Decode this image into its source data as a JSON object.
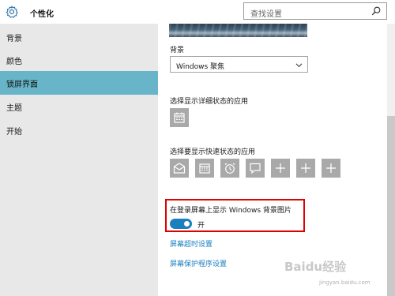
{
  "header": {
    "title": "个性化",
    "search_placeholder": "查找设置",
    "icon": "gear-icon"
  },
  "sidebar": {
    "items": [
      {
        "label": "背景",
        "selected": false
      },
      {
        "label": "颜色",
        "selected": false
      },
      {
        "label": "锁屏界面",
        "selected": true
      },
      {
        "label": "主题",
        "selected": false
      },
      {
        "label": "开始",
        "selected": false
      }
    ]
  },
  "main": {
    "background_label": "背景",
    "background_value": "Windows 聚焦",
    "detailed_status_label": "选择显示详细状态的应用",
    "quick_status_label": "选择要显示快速状态的应用",
    "quick_status_icons": [
      "mail-icon",
      "calendar-icon",
      "alarm-icon",
      "message-icon",
      "plus-icon",
      "plus-icon",
      "plus-icon"
    ],
    "show_bg_label": "在登录屏幕上显示 Windows 背景图片",
    "toggle_state": "开",
    "toggle_on": true,
    "link_timeout": "屏幕超时设置",
    "link_screensaver": "屏幕保护程序设置"
  },
  "watermark": {
    "logo": "Baidu经验",
    "url": "jingyan.baidu.com"
  },
  "colors": {
    "accent": "#1a7fbf",
    "selected_nav": "#68b5c9",
    "sidebar_bg": "#e8e8e8",
    "highlight_border": "#e00000"
  }
}
